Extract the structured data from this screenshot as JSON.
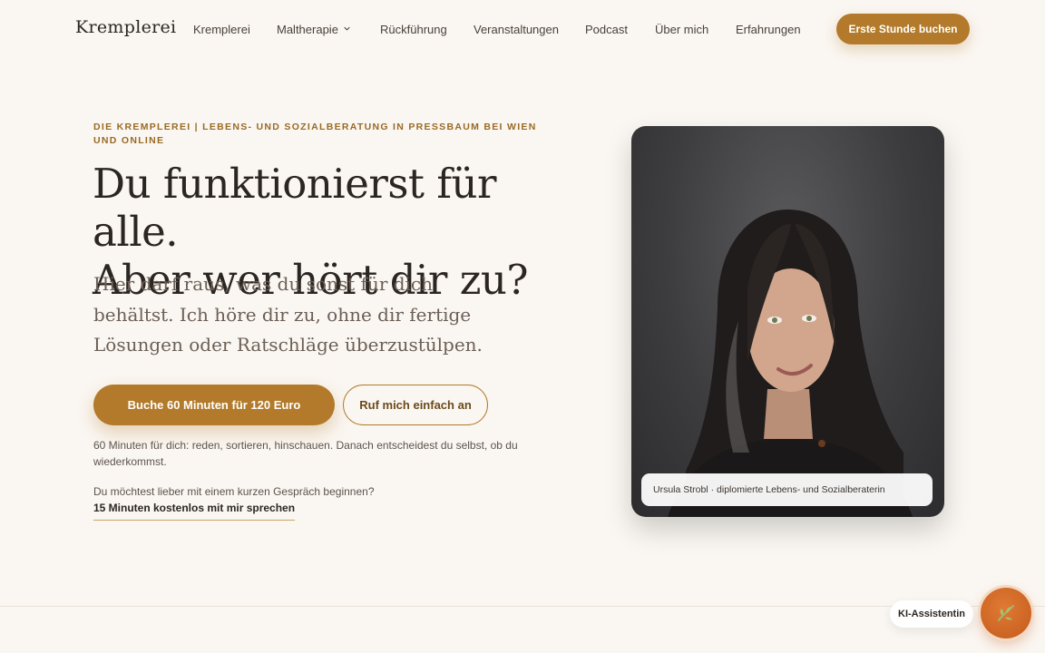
{
  "header": {
    "logo": "Kremplerei",
    "nav": [
      {
        "label": "Kremplerei"
      },
      {
        "label": "Maltherapie",
        "has_dropdown": true
      },
      {
        "label": "Rückführung"
      },
      {
        "label": "Veranstaltungen"
      },
      {
        "label": "Podcast"
      },
      {
        "label": "Über mich"
      },
      {
        "label": "Erfahrungen"
      }
    ],
    "cta": "Erste Stunde buchen"
  },
  "hero": {
    "eyebrow": "Die Kremplerei | Lebens- und Sozialberatung in Pressbaum bei Wien und online",
    "headline_line1": "Du funktionierst für alle.",
    "headline_line2": "Aber wer hört dir zu?",
    "subline": "Hier darf raus, was du sonst für dich behältst. Ich höre dir zu, ohne dir fertige Lösungen oder Ratschläge überzustülpen.",
    "primary_button": "Buche 60 Minuten für 120 Euro",
    "secondary_button": "Ruf mich einfach an",
    "note": "60 Minuten für dich: reden, sortieren, hinschauen. Danach entscheidest du selbst, ob du wiederkommst.",
    "question": "Du möchtest lieber mit einem kurzen Gespräch beginnen?",
    "free_link": "15 Minuten kostenlos mit mir sprechen"
  },
  "portrait": {
    "caption": "Ursula Strobl · diplomierte Lebens- und Sozialberaterin"
  },
  "assistant": {
    "label": "KI-Assistentin",
    "icon": "leaf-icon"
  },
  "colors": {
    "background": "#faf6f1",
    "accent": "#b27a2a",
    "text": "#2b2622",
    "assistant": "#d0682a"
  }
}
